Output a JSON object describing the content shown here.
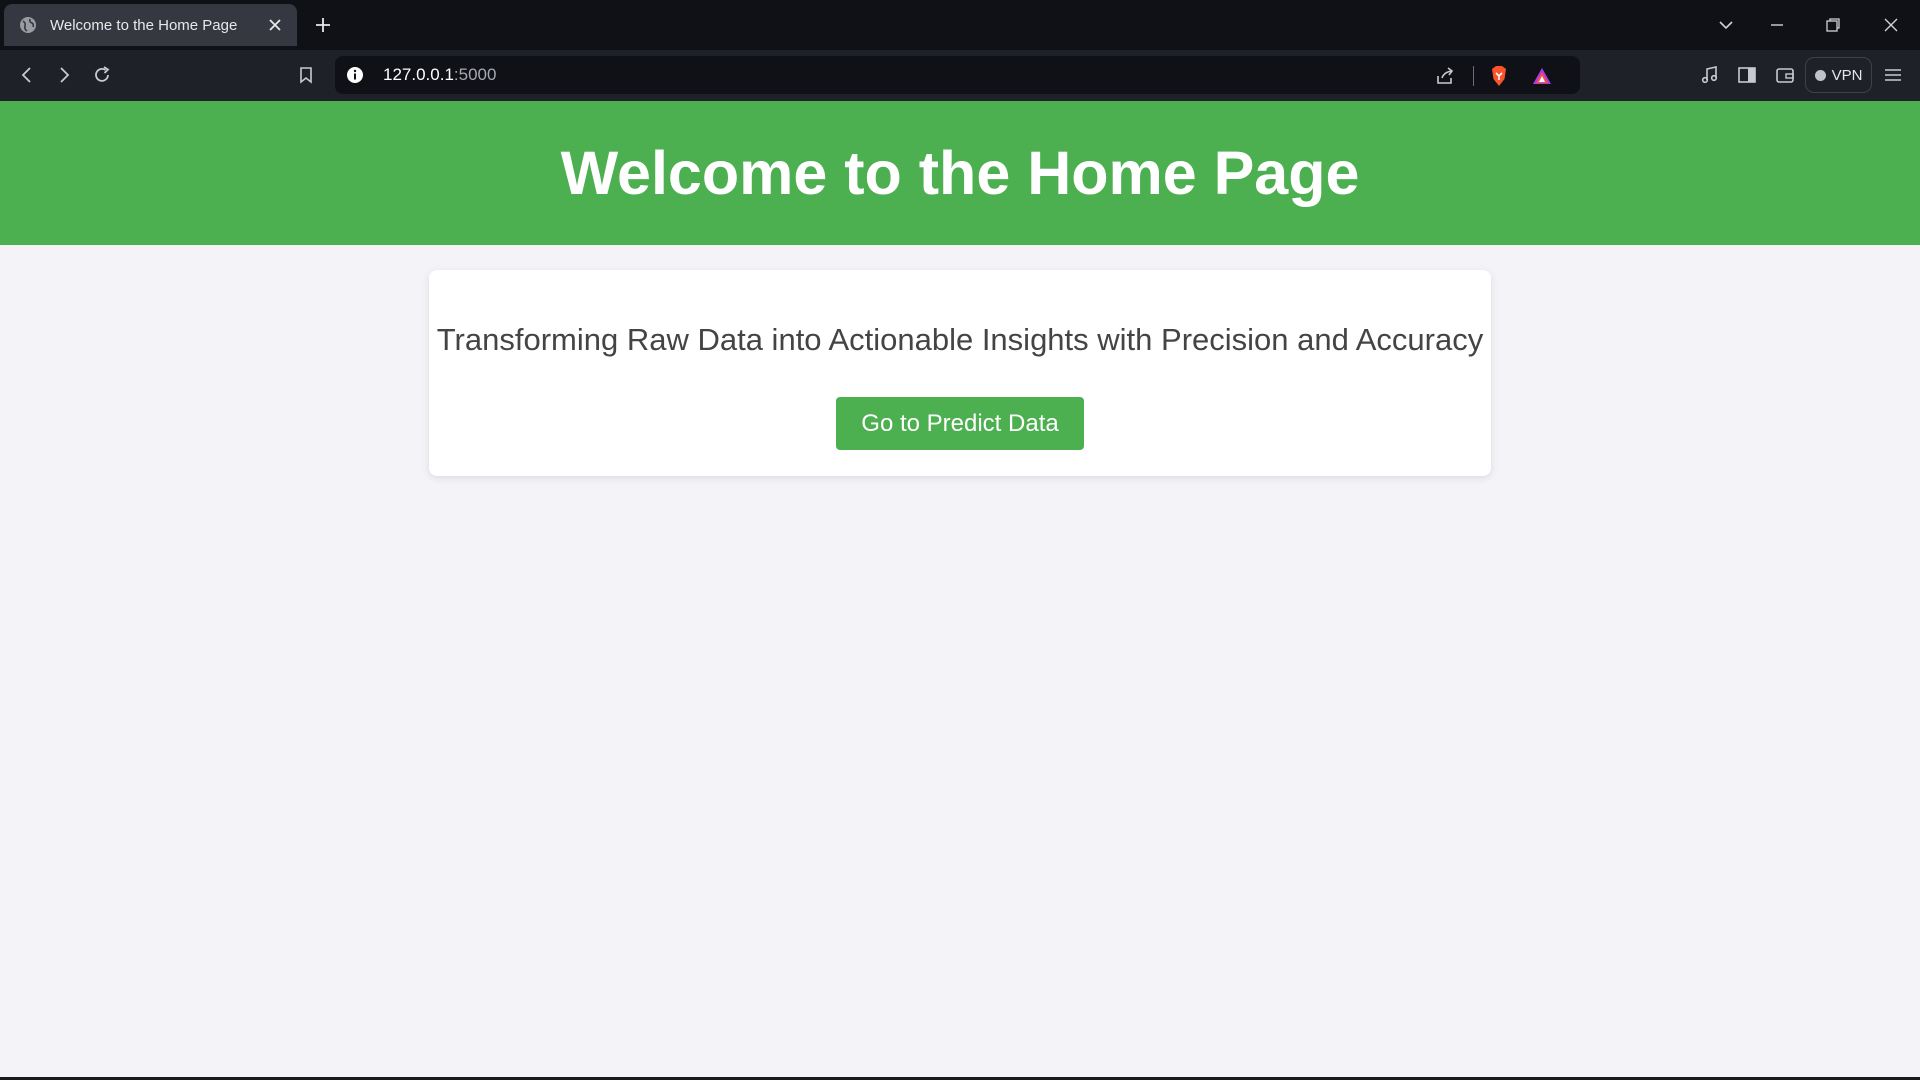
{
  "browser": {
    "tab_title": "Welcome to the Home Page",
    "url_host": "127.0.0.1",
    "url_port": ":5000",
    "vpn_label": "VPN",
    "icons": [
      "globe-icon",
      "close-icon",
      "plus-icon",
      "chevron-down-icon",
      "minimize-icon",
      "restore-icon",
      "window-close-icon",
      "back-icon",
      "forward-icon",
      "reload-icon",
      "bookmark-icon",
      "info-icon",
      "share-icon",
      "brave-shield-icon",
      "brave-rewards-icon",
      "music-icon",
      "sidebar-icon",
      "wallet-icon",
      "menu-icon"
    ]
  },
  "page": {
    "heading": "Welcome to the Home Page",
    "tagline": "Transforming Raw Data into Actionable Insights with Precision and Accuracy",
    "cta_label": "Go to Predict Data"
  },
  "colors": {
    "header_bg": "#4caf50",
    "button_bg": "#4caf50",
    "page_bg": "#f4f4f8",
    "text": "#444444"
  }
}
